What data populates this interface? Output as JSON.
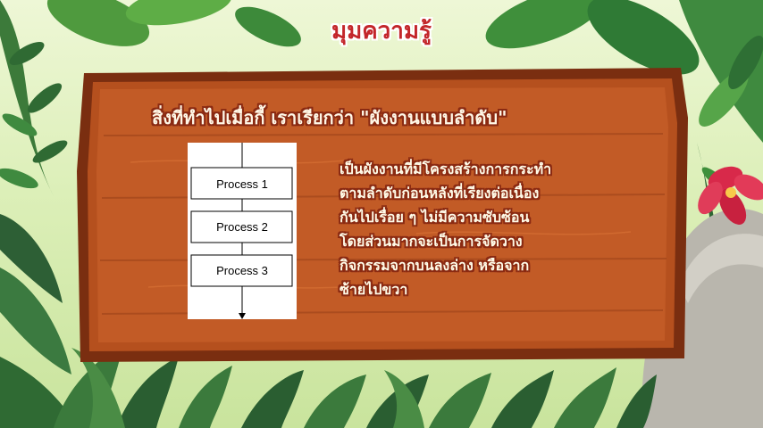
{
  "title": "มุมความรู้",
  "heading": "สิ่งที่ทำไปเมื่อกี้ เราเรียกว่า \"ผังงานแบบลำดับ\"",
  "flowchart": {
    "steps": [
      "Process 1",
      "Process 2",
      "Process 3"
    ]
  },
  "description": [
    "เป็นผังงานที่มีโครงสร้างการกระทำ",
    "ตามลำดับก่อนหลังที่เรียงต่อเนื่อง",
    "กันไปเรื่อย ๆ ไม่มีความซับซ้อน",
    "โดยส่วนมากจะเป็นการจัดวาง",
    "กิจกรรมจากบนลงล่าง หรือจาก",
    "ซ้ายไปขวา"
  ],
  "colors": {
    "title_text": "#c3262a",
    "board_wood": "#b5501e",
    "board_frame": "#7a2e10",
    "text_outline": "#8a2a12"
  },
  "icons": [
    "leaf-icon",
    "hibiscus-flower-icon",
    "rock-icon"
  ]
}
